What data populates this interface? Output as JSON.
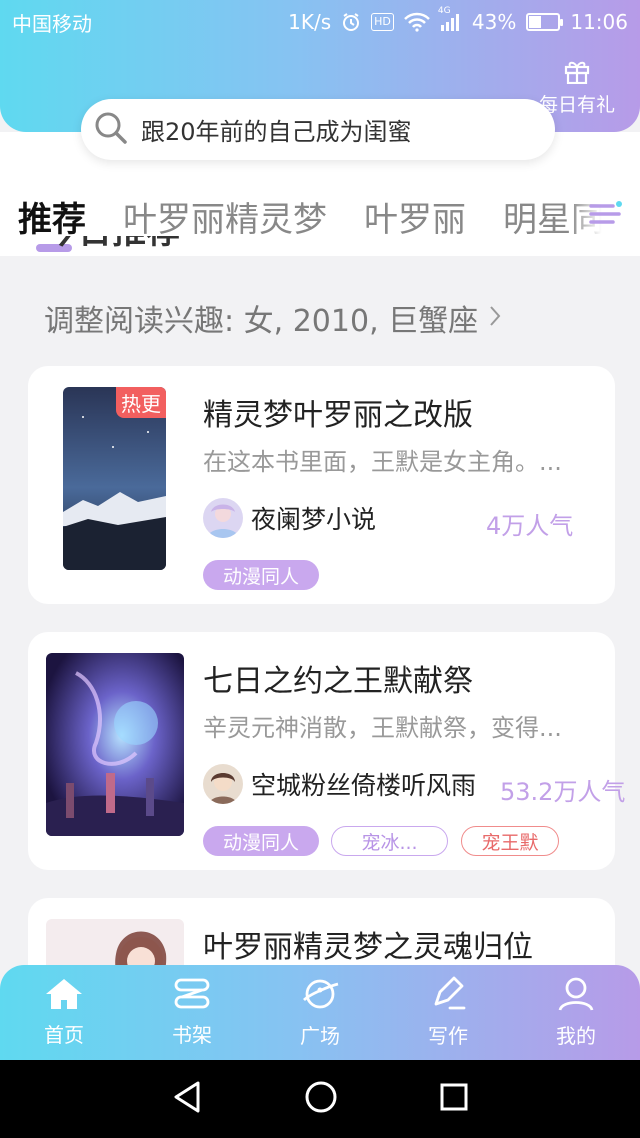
{
  "status_bar": {
    "carrier": "中国移动",
    "speed": "1K/s",
    "hd": "HD",
    "network": "4G",
    "battery_percent": "43%",
    "battery_level": 0.43,
    "time": "11:06"
  },
  "header": {
    "gift_label": "每日有礼",
    "search_placeholder": "跟20年前的自己成为闺蜜"
  },
  "tabs": [
    {
      "label": "推荐",
      "active": true
    },
    {
      "label": "叶罗丽精灵梦",
      "active": false
    },
    {
      "label": "叶罗丽",
      "active": false
    },
    {
      "label": "明星同人",
      "active": false
    }
  ],
  "section": {
    "title": "今日推荐",
    "reading_pref": "调整阅读兴趣: 女, 2010, 巨蟹座"
  },
  "books": [
    {
      "title": "精灵梦叶罗丽之改版",
      "desc": "在这本书里面，王默是女主角。...",
      "author": "夜阑梦小说",
      "popularity": "4万人气",
      "badge": "热更",
      "tags": [
        "动漫同人"
      ]
    },
    {
      "title": "七日之约之王默献祭",
      "desc": "辛灵元神消散，王默献祭，变得...",
      "author": "空城粉丝倚楼听风雨",
      "popularity": "53.2万人气",
      "tags": [
        "动漫同人",
        "宠冰...",
        "宠王默"
      ]
    },
    {
      "title": "叶罗丽精灵梦之灵魂归位"
    }
  ],
  "bottom_nav": [
    {
      "label": "首页",
      "icon": "home-icon"
    },
    {
      "label": "书架",
      "icon": "bookshelf-icon"
    },
    {
      "label": "广场",
      "icon": "planet-icon"
    },
    {
      "label": "写作",
      "icon": "pen-icon"
    },
    {
      "label": "我的",
      "icon": "user-icon"
    }
  ],
  "colors": {
    "gradient_start": "#5fd9f0",
    "gradient_end": "#b79be8",
    "popularity": "#c2a0e8",
    "hot": "#f25f5f"
  }
}
